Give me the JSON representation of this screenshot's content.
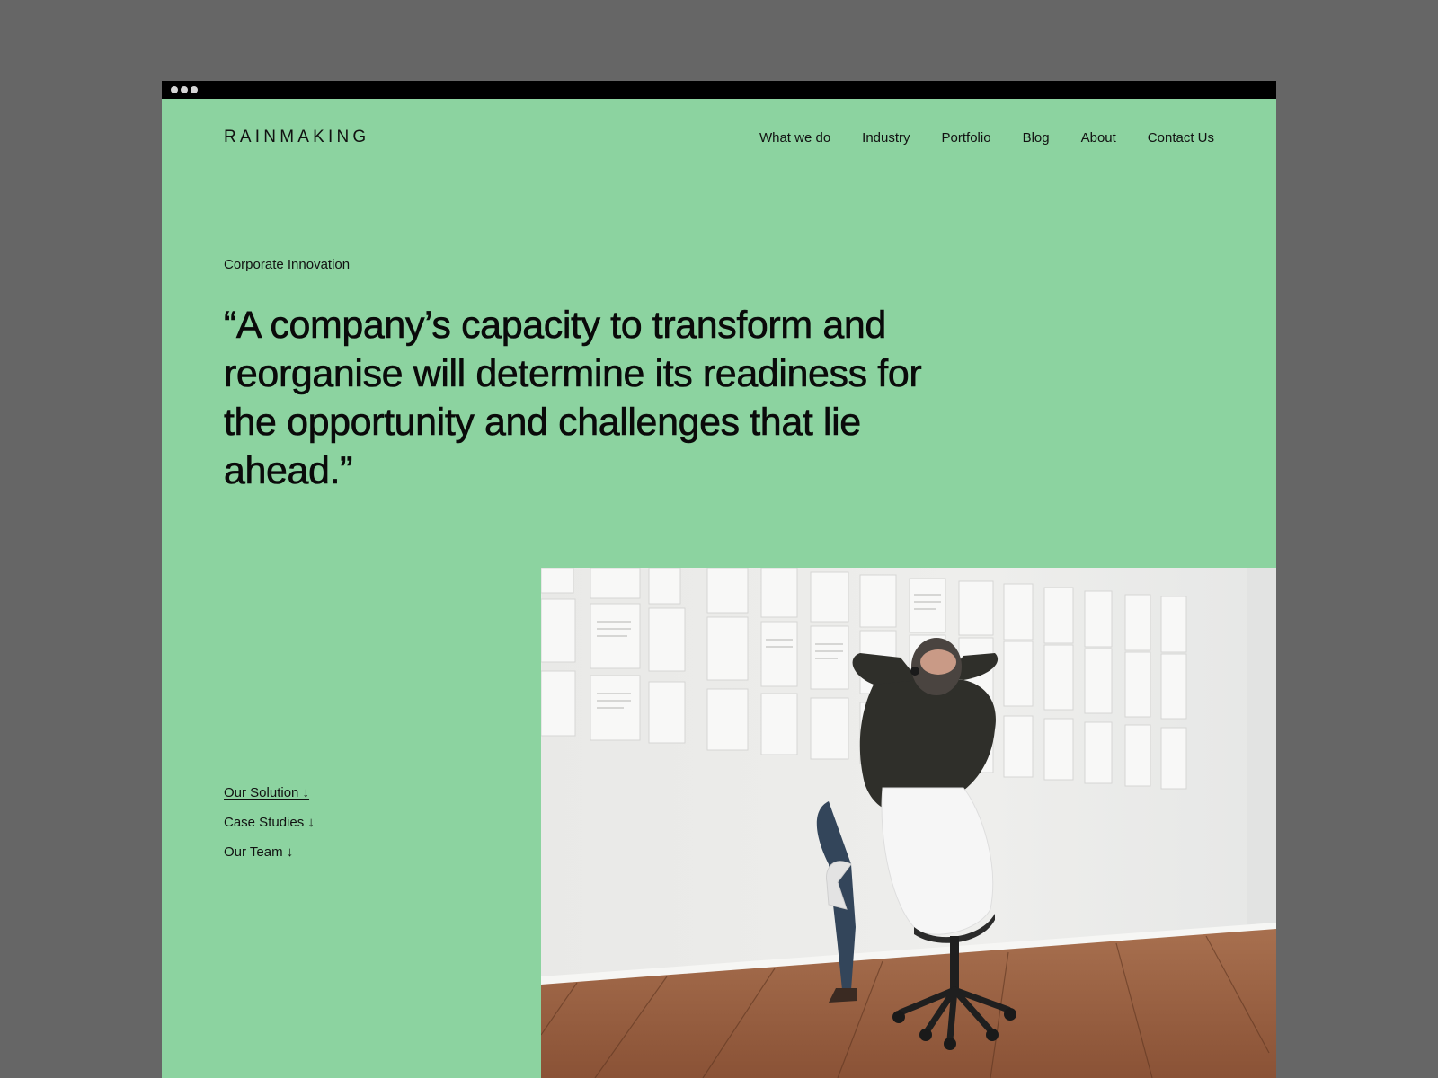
{
  "browser": {
    "window_controls": [
      "dot",
      "dot",
      "dot"
    ]
  },
  "header": {
    "logo": "RAINMAKING",
    "nav": [
      {
        "label": "What we do"
      },
      {
        "label": "Industry"
      },
      {
        "label": "Portfolio"
      },
      {
        "label": "Blog"
      },
      {
        "label": "About"
      },
      {
        "label": "Contact Us"
      }
    ]
  },
  "hero": {
    "eyebrow": "Corporate Innovation",
    "quote": "“A company’s capacity to transform and reorganise will determine its readiness for the opportunity and challenges that lie ahead.”"
  },
  "anchors": [
    {
      "label": "Our Solution ↓",
      "active": true
    },
    {
      "label": "Case Studies ↓",
      "active": false
    },
    {
      "label": "Our Team ↓",
      "active": false
    }
  ],
  "image": {
    "alt": "Man sitting in white office chair with hands behind head looking at wall of printed documents"
  },
  "colors": {
    "background": "#666666",
    "page": "#8cd3a0",
    "topbar": "#000000",
    "text": "#111111"
  }
}
